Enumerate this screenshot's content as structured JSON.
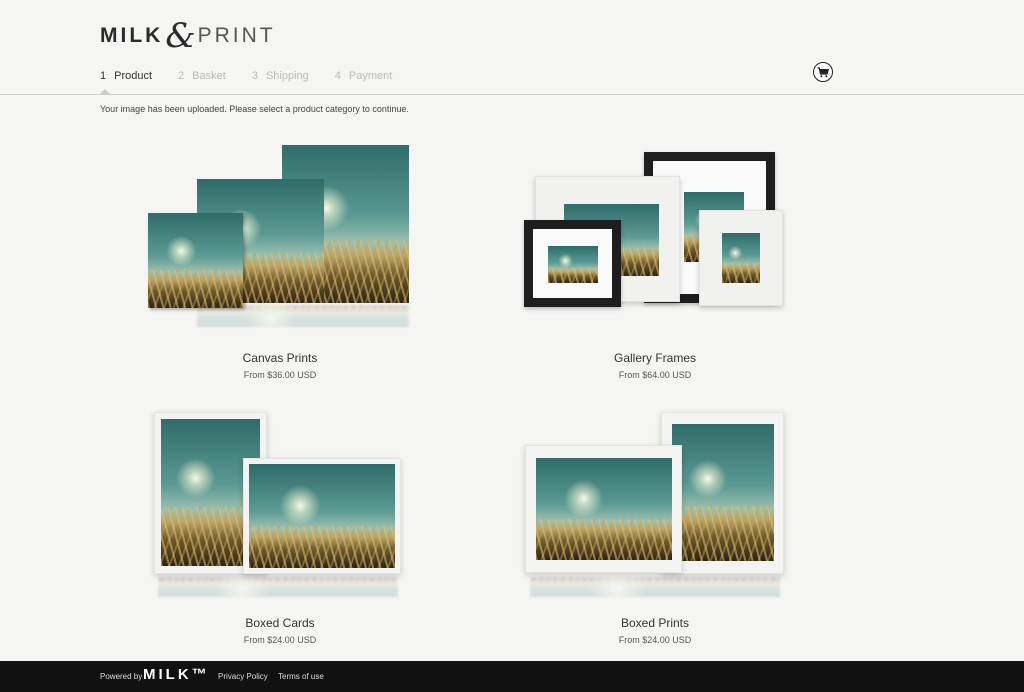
{
  "logo": {
    "milk": "MILK",
    "amp": "&",
    "print": "PRINT"
  },
  "steps": [
    {
      "num": "1",
      "label": "Product",
      "active": true
    },
    {
      "num": "2",
      "label": "Basket",
      "active": false
    },
    {
      "num": "3",
      "label": "Shipping",
      "active": false
    },
    {
      "num": "4",
      "label": "Payment",
      "active": false
    }
  ],
  "cart": {
    "icon": "cart-icon"
  },
  "notice": "Your image has been uploaded. Please select a product category to continue.",
  "products": [
    {
      "name": "Canvas Prints",
      "price": "From $36.00 USD"
    },
    {
      "name": "Gallery Frames",
      "price": "From $64.00 USD"
    },
    {
      "name": "Boxed Cards",
      "price": "From $24.00 USD"
    },
    {
      "name": "Boxed Prints",
      "price": "From $24.00 USD"
    }
  ],
  "footer": {
    "powered_by": "Powered by",
    "brand": "MILK™",
    "privacy": "Privacy Policy",
    "terms": "Terms of use"
  }
}
